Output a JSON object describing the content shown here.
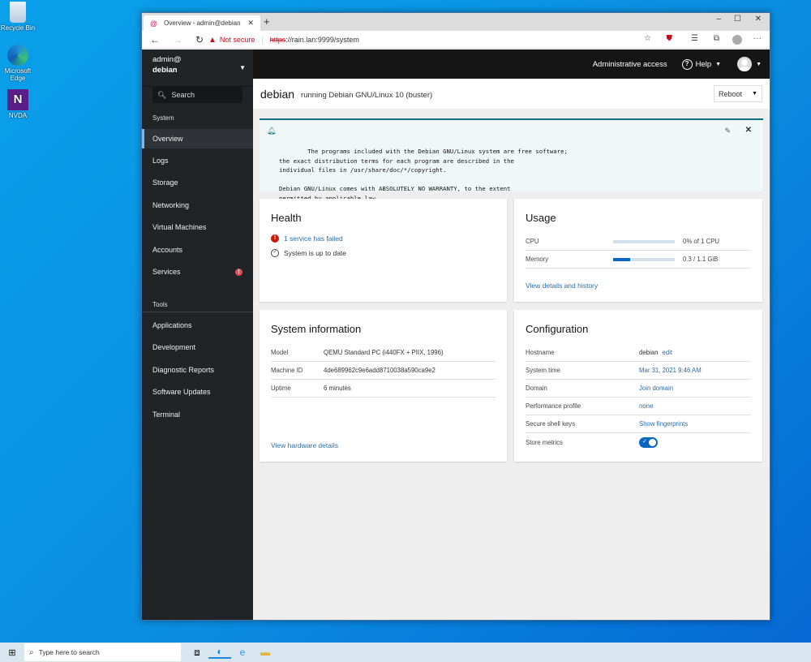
{
  "desktop": {
    "icons": [
      {
        "label": "Recycle Bin",
        "icon": "recycle-bin-icon"
      },
      {
        "label": "Microsoft Edge",
        "icon": "edge-icon"
      },
      {
        "label": "NVDA",
        "icon": "nvda-icon"
      }
    ]
  },
  "browser": {
    "tab_title": "Overview - admin@debian",
    "new_tab": "+",
    "security_label": "Not secure",
    "url_scheme": "https",
    "url_rest": "://rain.lan:9999/system",
    "window_controls": {
      "minimize": "–",
      "maximize": "☐",
      "close": "✕"
    }
  },
  "sidebar": {
    "user": "admin@",
    "host": "debian",
    "search_placeholder": "Search",
    "system_label": "System",
    "system_items": [
      {
        "label": "Overview",
        "active": true
      },
      {
        "label": "Logs"
      },
      {
        "label": "Storage"
      },
      {
        "label": "Networking"
      },
      {
        "label": "Virtual Machines"
      },
      {
        "label": "Accounts"
      },
      {
        "label": "Services",
        "badge": "!"
      }
    ],
    "tools_label": "Tools",
    "tools_items": [
      {
        "label": "Applications"
      },
      {
        "label": "Development"
      },
      {
        "label": "Diagnostic Reports"
      },
      {
        "label": "Software Updates"
      },
      {
        "label": "Terminal"
      }
    ]
  },
  "header": {
    "admin_access": "Administrative access",
    "help": "Help"
  },
  "page": {
    "hostname": "debian",
    "os": "running Debian GNU/Linux 10 (buster)",
    "reboot": "Reboot"
  },
  "motd": {
    "text": "The programs included with the Debian GNU/Linux system are free software;\nthe exact distribution terms for each program are described in the\nindividual files in /usr/share/doc/*/copyright.\n\nDebian GNU/Linux comes with ABSOLUTELY NO WARRANTY, to the extent\npermitted by applicable law."
  },
  "health": {
    "title": "Health",
    "failed": "1 service has failed",
    "updates": "System is up to date"
  },
  "usage": {
    "title": "Usage",
    "cpu_label": "CPU",
    "cpu_value": "0% of 1 CPU",
    "cpu_fraction": 0.0,
    "memory_label": "Memory",
    "memory_value": "0.3 / 1.1 GiB",
    "memory_fraction": 0.27,
    "link": "View details and history"
  },
  "sysinfo": {
    "title": "System information",
    "rows": [
      {
        "key": "Model",
        "value": "QEMU Standard PC (i440FX + PIIX, 1996)"
      },
      {
        "key": "Machine ID",
        "value": "4de689962c9e6add8710038a590ca9e2"
      },
      {
        "key": "Uptime",
        "value": "6 minutes"
      }
    ],
    "link": "View hardware details"
  },
  "config": {
    "title": "Configuration",
    "hostname_key": "Hostname",
    "hostname_value": "debian",
    "hostname_edit": "edit",
    "time_key": "System time",
    "time_value": "Mar 31, 2021 9:46 AM",
    "domain_key": "Domain",
    "domain_value": "Join domain",
    "perf_key": "Performance profile",
    "perf_value": "none",
    "ssh_key": "Secure shell keys",
    "ssh_value": "Show fingerprints",
    "metrics_key": "Store metrics",
    "metrics_on": true
  },
  "taskbar": {
    "search_placeholder": "Type here to search"
  }
}
